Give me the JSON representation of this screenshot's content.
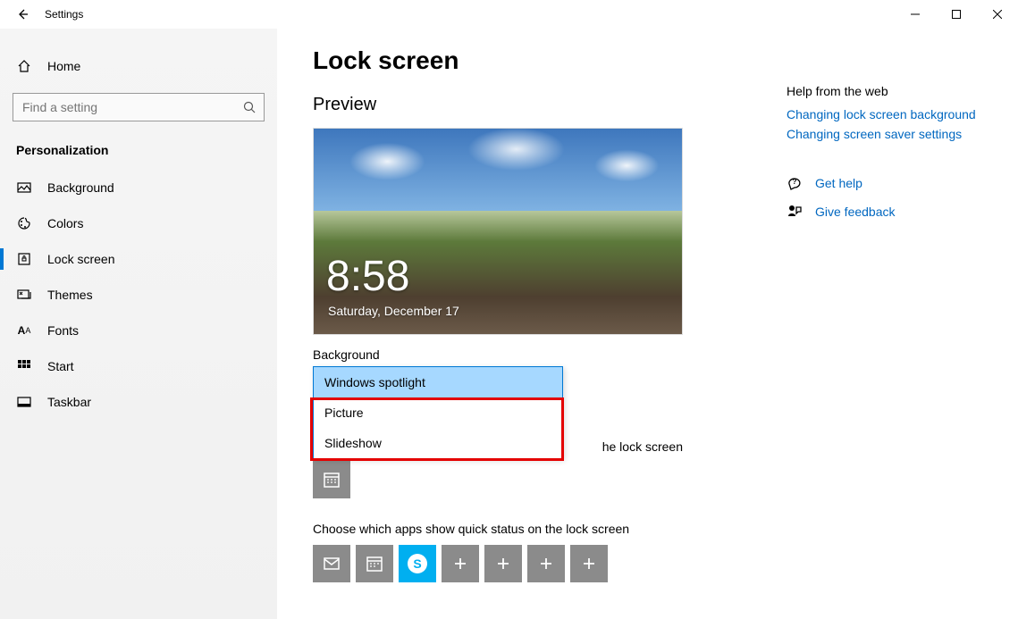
{
  "window": {
    "title": "Settings"
  },
  "sidebar": {
    "home": "Home",
    "search_placeholder": "Find a setting",
    "section": "Personalization",
    "items": [
      {
        "label": "Background"
      },
      {
        "label": "Colors"
      },
      {
        "label": "Lock screen"
      },
      {
        "label": "Themes"
      },
      {
        "label": "Fonts"
      },
      {
        "label": "Start"
      },
      {
        "label": "Taskbar"
      }
    ]
  },
  "page": {
    "title": "Lock screen",
    "preview_label": "Preview",
    "clock": "8:58",
    "date": "Saturday, December 17",
    "background_label": "Background",
    "dropdown": {
      "options": [
        "Windows spotlight",
        "Picture",
        "Slideshow"
      ],
      "selected_index": 0
    },
    "detailed_label_suffix": "he lock screen",
    "quick_status_label": "Choose which apps show quick status on the lock screen",
    "quick_tiles": [
      "mail",
      "calendar",
      "skype",
      "add",
      "add",
      "add",
      "add"
    ]
  },
  "help": {
    "heading": "Help from the web",
    "links": [
      "Changing lock screen background",
      "Changing screen saver settings"
    ],
    "get_help": "Get help",
    "feedback": "Give feedback"
  }
}
